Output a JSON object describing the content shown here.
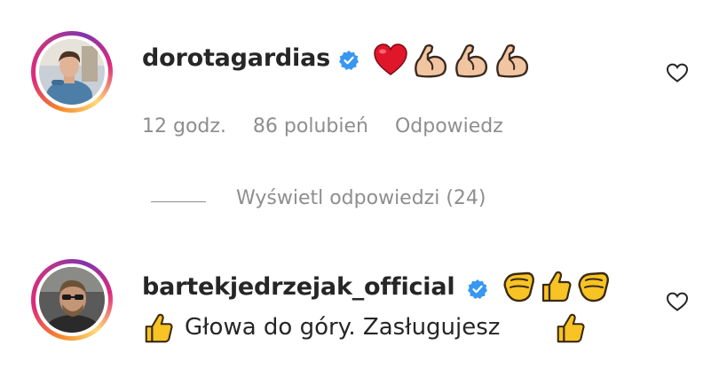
{
  "comments": [
    {
      "username": "dorotagardias",
      "emoji_text": "",
      "time": "12 godz.",
      "likes": "86 polubień",
      "reply_label": "Odpowiedz",
      "view_replies": "Wyświetl odpowiedzi (24)"
    },
    {
      "username": "bartekjedrzejak_official",
      "text_before": "",
      "text": "Głowa do góry. Zasługujesz"
    }
  ],
  "colors": {
    "verified": "#3897f0",
    "muted": "#8e8e8e",
    "text": "#262626",
    "heart": "#e0162b",
    "emoji_yellow": "#f7c325"
  },
  "icons": {
    "like": "heart-outline-icon",
    "verified": "verified-badge-icon",
    "emojis_first": [
      "red-heart-icon",
      "flexed-biceps-icon",
      "flexed-biceps-icon",
      "flexed-biceps-icon"
    ],
    "emojis_second": [
      "clapping-hands-icon",
      "thumbs-up-icon",
      "clapping-hands-icon"
    ]
  }
}
